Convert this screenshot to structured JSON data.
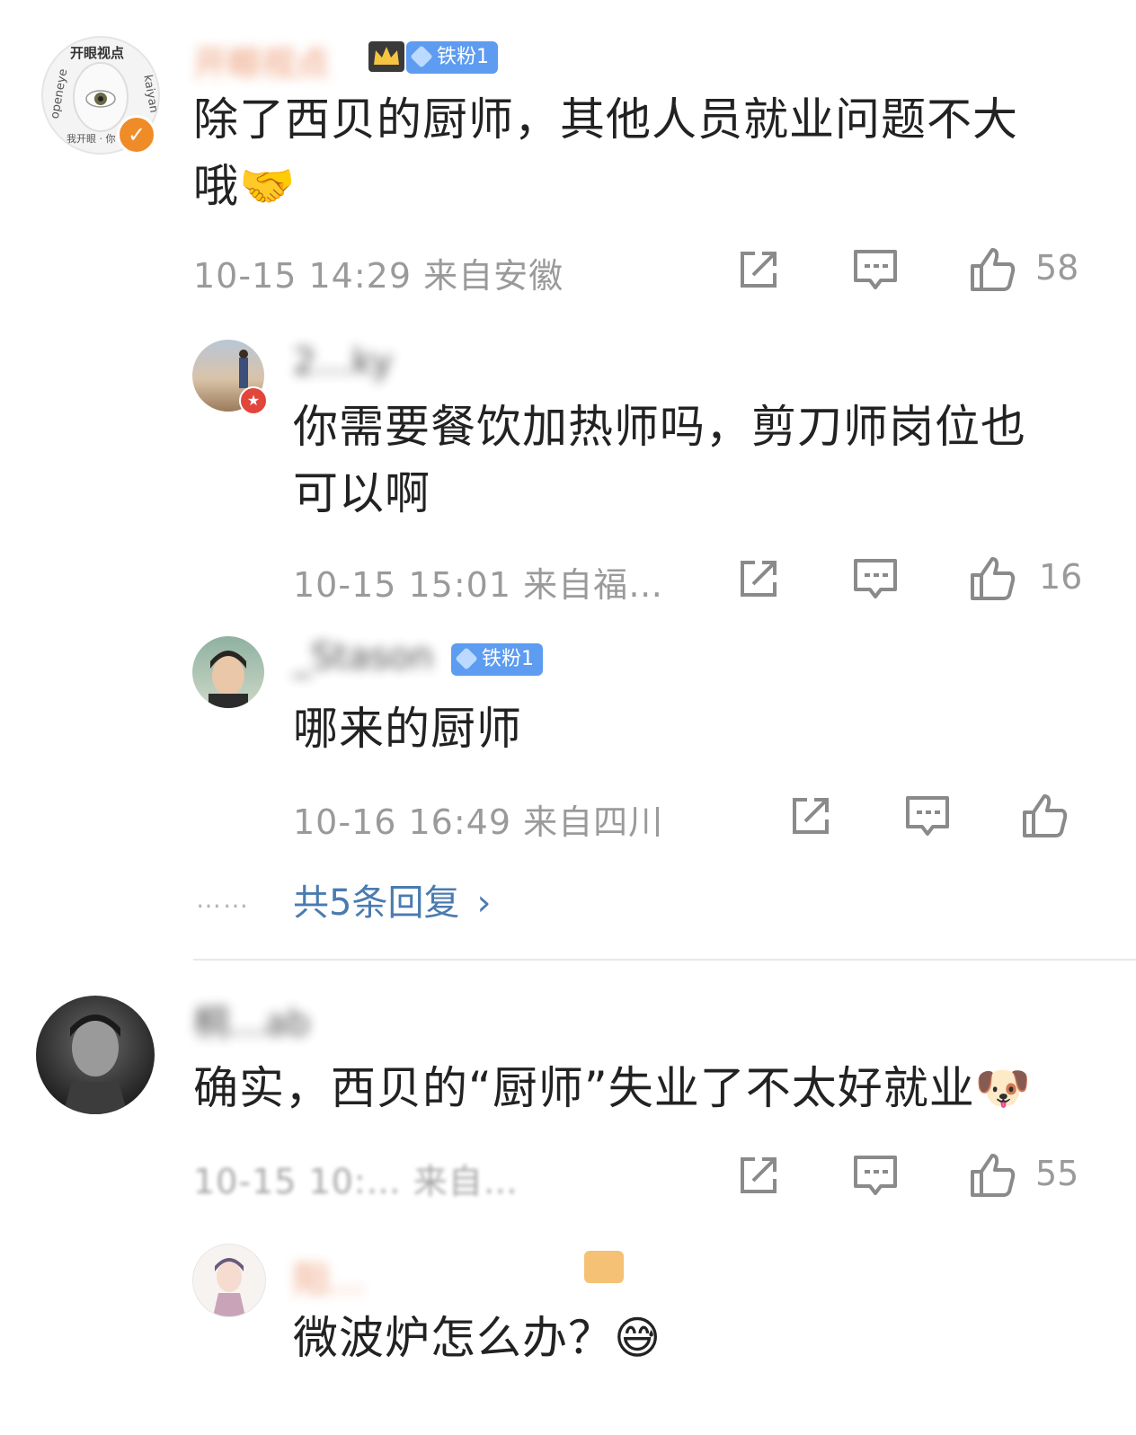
{
  "comments": [
    {
      "username": "开眼视点",
      "fan_badge": "铁粉1",
      "text_line1": "除了西贝的厨师，其他人员就业问题不大",
      "text_line2": "哦🤝",
      "time_location": "10-15 14:29  来自安徽",
      "like_count": "58",
      "avatar_text_top": "开眼视点",
      "avatar_text_left": "openeye",
      "avatar_text_right": "kaiyan",
      "avatar_text_bottom": "我开眼 · 你"
    },
    {
      "username": "2…ky",
      "text_line1": "你需要餐饮加热师吗，剪刀师岗位也",
      "text_line2": "可以啊",
      "time_location": "10-15 15:01  来自福…",
      "like_count": "16"
    },
    {
      "username": "_Stason",
      "fan_badge": "铁粉1",
      "text_line1": "哪来的厨师",
      "time_location": "10-16 16:49  来自四川",
      "like_count": ""
    },
    {
      "username": "桐…ab",
      "text_line1": "确实，西贝的“厨师”失业了不太好就业🐶",
      "time_location": "10-15 10:…  来自…",
      "like_count": "55"
    },
    {
      "username": "阳…",
      "text_line1": "微波炉怎么办？😅"
    }
  ],
  "replies_more": {
    "dots": "……",
    "label": "共5条回复",
    "chevron": "›"
  },
  "icons": {
    "share": "share-icon",
    "comment": "comment-icon",
    "like": "thumb-up-icon"
  },
  "colors": {
    "link": "#4a7bb0",
    "meta": "#9a9a9a",
    "badge": "#5d9cf0",
    "verified": "#f08c28"
  }
}
